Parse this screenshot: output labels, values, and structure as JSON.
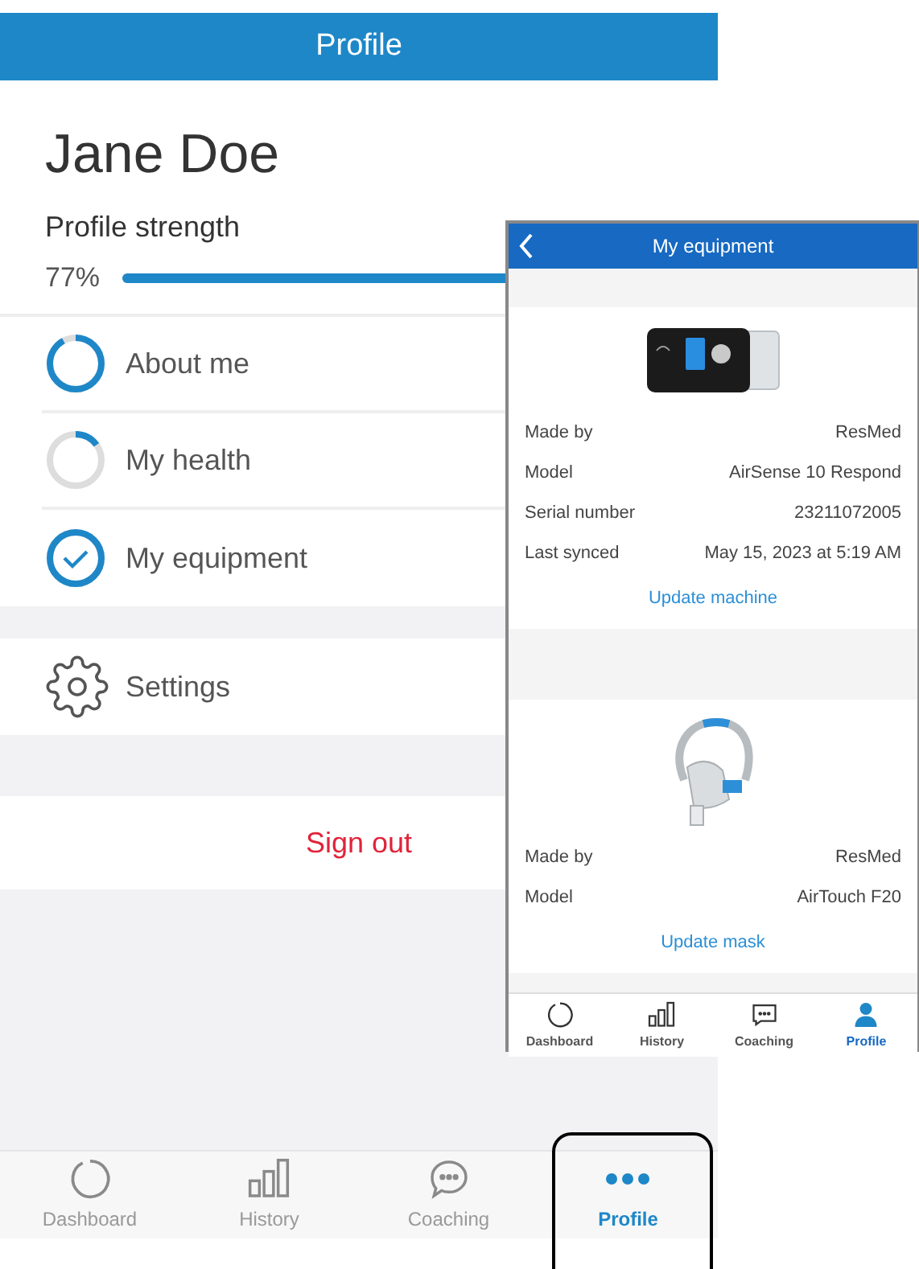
{
  "header": {
    "title": "Profile"
  },
  "user": {
    "name": "Jane Doe"
  },
  "profile_strength": {
    "label": "Profile strength",
    "reading": "77%",
    "level": 0.77
  },
  "sections": [
    {
      "label": "About me",
      "level": 0.92,
      "checked": false
    },
    {
      "label": "My health",
      "level": 0.15,
      "checked": false
    },
    {
      "label": "My equipment",
      "level": 1,
      "checked": true
    }
  ],
  "settings": {
    "label": "Settings"
  },
  "sign_out": {
    "label": "Sign out"
  },
  "tabs": [
    {
      "label": "Dashboard",
      "selected": false
    },
    {
      "label": "History",
      "selected": false
    },
    {
      "label": "Coaching",
      "selected": false
    },
    {
      "label": "Profile",
      "selected": true
    }
  ],
  "equipment_screen": {
    "title": "My equipment",
    "devices": [
      {
        "rows": [
          {
            "label": "Made by",
            "value": "ResMed"
          },
          {
            "label": "Model",
            "value": "AirSense 10 Respond"
          },
          {
            "label": "Serial number",
            "value": "23211072005"
          },
          {
            "label": "Last synced",
            "value": "May 15, 2023 at 5:19 AM"
          }
        ],
        "action": "Update machine"
      },
      {
        "rows": [
          {
            "label": "Made by",
            "value": "ResMed"
          },
          {
            "label": "Model",
            "value": "AirTouch F20"
          }
        ],
        "action": "Update mask"
      }
    ],
    "tabs": [
      {
        "label": "Dashboard",
        "selected": false
      },
      {
        "label": "History",
        "selected": false
      },
      {
        "label": "Coaching",
        "selected": false
      },
      {
        "label": "Profile",
        "selected": true
      }
    ]
  }
}
